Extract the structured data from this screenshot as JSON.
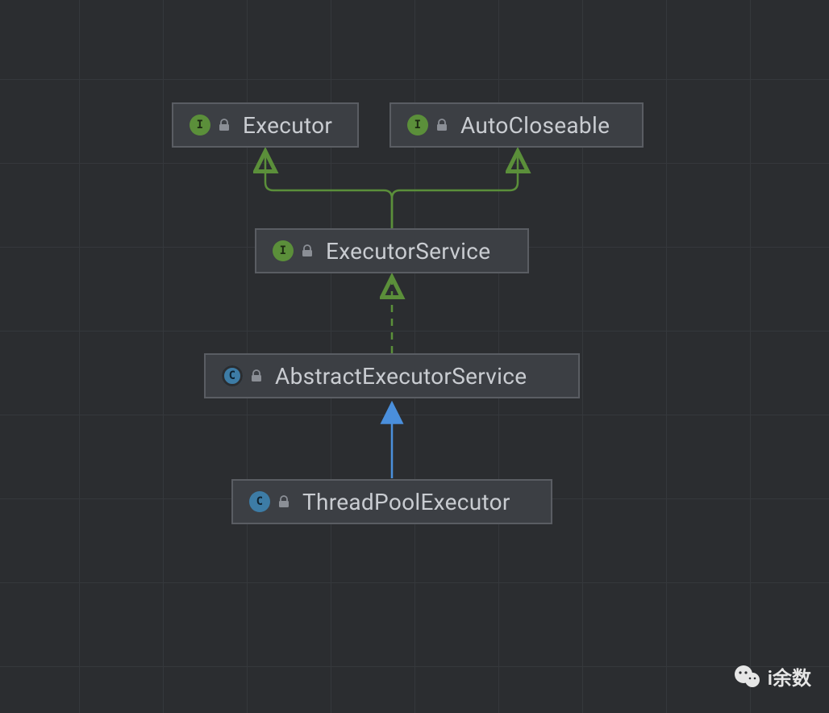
{
  "nodes": {
    "executor": {
      "kind": "I",
      "kindLabel": "interface",
      "label": "Executor"
    },
    "autocloseable": {
      "kind": "I",
      "kindLabel": "interface",
      "label": "AutoCloseable"
    },
    "executorService": {
      "kind": "I",
      "kindLabel": "interface",
      "label": "ExecutorService"
    },
    "abstractExecutorService": {
      "kind": "C",
      "kindLabel": "abstract-class",
      "label": "AbstractExecutorService"
    },
    "threadPoolExecutor": {
      "kind": "C",
      "kindLabel": "class",
      "label": "ThreadPoolExecutor"
    }
  },
  "edges": [
    {
      "from": "executorService",
      "to": "executor",
      "style": "solid-green",
      "relation": "extends-interface"
    },
    {
      "from": "executorService",
      "to": "autocloseable",
      "style": "solid-green",
      "relation": "extends-interface"
    },
    {
      "from": "abstractExecutorService",
      "to": "executorService",
      "style": "dashed-green",
      "relation": "implements"
    },
    {
      "from": "threadPoolExecutor",
      "to": "abstractExecutorService",
      "style": "solid-blue",
      "relation": "extends-class"
    }
  ],
  "watermark": {
    "label": "i余数"
  },
  "colors": {
    "green": "#5b8f3a",
    "blue": "#4a8fdc",
    "node_border": "#5a5d63",
    "node_bg": "#3c3f44"
  }
}
